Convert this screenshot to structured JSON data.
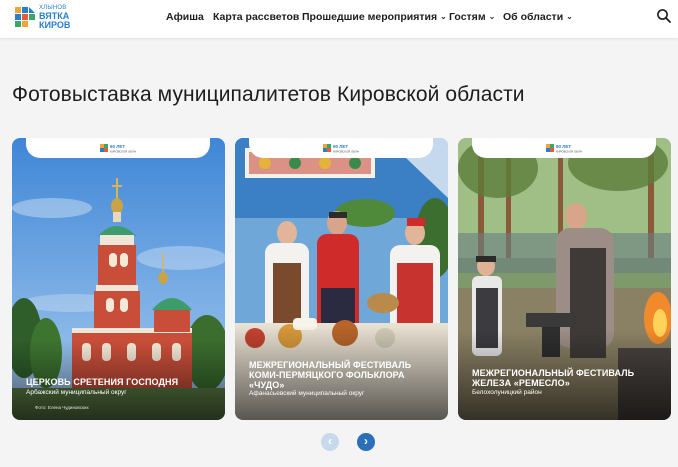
{
  "header": {
    "logo": {
      "line1": "ХЛЫНОВ",
      "line2": "ВЯТКА",
      "line3": "КИРОВ"
    },
    "nav": [
      {
        "label": "Афиша",
        "dropdown": false
      },
      {
        "label": "Карта рассветов",
        "dropdown": false
      },
      {
        "label": "Прошедшие мероприятия",
        "dropdown": true
      },
      {
        "label": "Гостям",
        "dropdown": true
      },
      {
        "label": "Об области",
        "dropdown": true
      }
    ],
    "search_icon": "search-icon"
  },
  "page_title": "Фотовыставка муниципалитетов Кировской области",
  "cards": [
    {
      "badge": "90 ЛЕТ КИРОВСКОЙ ОБЛАСТИ",
      "title": "Церковь Сретения Господня",
      "subtitle": "Арбажский муниципальный округ",
      "credit": "Фото: Елена Чудиновских"
    },
    {
      "badge": "90 ЛЕТ КИРОВСКОЙ ОБЛАСТИ",
      "title": "Межрегиональный фестиваль Коми-пермяцкого фольклора «Чудо»",
      "subtitle": "Афанасьевский муниципальный округ",
      "credit": ""
    },
    {
      "badge": "90 ЛЕТ КИРОВСКОЙ ОБЛАСТИ",
      "title": "Межрегиональный фестиваль железа «Ремесло»",
      "subtitle": "Белохолуницкий район",
      "credit": ""
    }
  ],
  "pager": {
    "prev_icon": "chevron-left-icon",
    "next_icon": "chevron-right-icon"
  },
  "colors": {
    "accent": "#2a6fb8",
    "accent_light": "#c9d9ec",
    "logo_blue": "#2a7fc9"
  }
}
